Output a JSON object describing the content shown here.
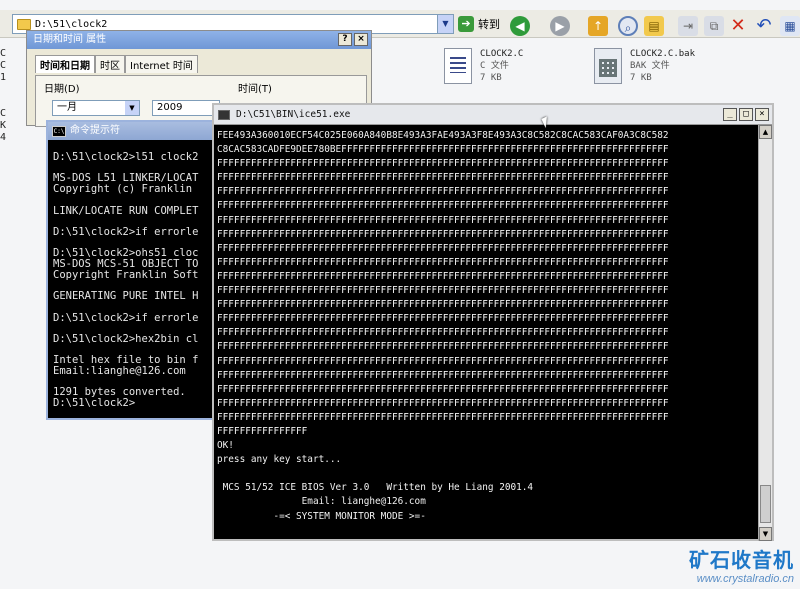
{
  "explorer": {
    "address": "D:\\51\\clock2",
    "go_label": "转到",
    "left_stub_1": "C\nC\n1",
    "left_stub_2": "C\nK\n4",
    "files": [
      {
        "name": "CLOCK2.C",
        "type": "C 文件",
        "size": "7 KB",
        "icon": "c-source-file-icon"
      },
      {
        "name": "CLOCK2.C.bak",
        "type": "BAK 文件",
        "size": "7 KB",
        "icon": "bak-file-icon"
      }
    ],
    "toolbar_icons": [
      "back-icon",
      "forward-icon",
      "up-folder-icon",
      "search-icon",
      "folders-icon",
      "move-to-icon",
      "copy-to-icon",
      "delete-icon",
      "undo-icon",
      "views-icon"
    ]
  },
  "datetime_dialog": {
    "title": "日期和时间 属性",
    "tabs": [
      "时间和日期",
      "时区",
      "Internet 时间"
    ],
    "date_group": "日期(D)",
    "month": "一月",
    "year": "2009",
    "time_group": "时间(T)"
  },
  "cmd_window": {
    "title": "命令提示符",
    "icon_text": "C:\\",
    "content": "D:\\51\\clock2>l51 clock2\n\nMS-DOS L51 LINKER/LOCAT\nCopyright (c) Franklin\n\nLINK/LOCATE RUN COMPLET\n\nD:\\51\\clock2>if errorle\n\nD:\\51\\clock2>ohs51 cloc\nMS-DOS MCS-51 OBJECT TO\nCopyright Franklin Soft\n\nGENERATING PURE INTEL H\n\nD:\\51\\clock2>if errorle\n\nD:\\51\\clock2>hex2bin cl\n\nIntel hex file to bin f\nEmail:lianghe@126.com\n\n1291 bytes converted.\nD:\\51\\clock2>"
  },
  "ice_window": {
    "title": "D:\\C51\\BIN\\ice51.exe",
    "content": "FEE493A360010ECF54C025E060A840B8E493A3FAE493A3F8E493A3C8C582C8CAC583CAF0A3C8C582\nC8CAC583CADFE9DEE780BEFFFFFFFFFFFFFFFFFFFFFFFFFFFFFFFFFFFFFFFFFFFFFFFFFFFFFFFFFF\nFFFFFFFFFFFFFFFFFFFFFFFFFFFFFFFFFFFFFFFFFFFFFFFFFFFFFFFFFFFFFFFFFFFFFFFFFFFFFFFF\nFFFFFFFFFFFFFFFFFFFFFFFFFFFFFFFFFFFFFFFFFFFFFFFFFFFFFFFFFFFFFFFFFFFFFFFFFFFFFFFF\nFFFFFFFFFFFFFFFFFFFFFFFFFFFFFFFFFFFFFFFFFFFFFFFFFFFFFFFFFFFFFFFFFFFFFFFFFFFFFFFF\nFFFFFFFFFFFFFFFFFFFFFFFFFFFFFFFFFFFFFFFFFFFFFFFFFFFFFFFFFFFFFFFFFFFFFFFFFFFFFFFF\nFFFFFFFFFFFFFFFFFFFFFFFFFFFFFFFFFFFFFFFFFFFFFFFFFFFFFFFFFFFFFFFFFFFFFFFFFFFFFFFF\nFFFFFFFFFFFFFFFFFFFFFFFFFFFFFFFFFFFFFFFFFFFFFFFFFFFFFFFFFFFFFFFFFFFFFFFFFFFFFFFF\nFFFFFFFFFFFFFFFFFFFFFFFFFFFFFFFFFFFFFFFFFFFFFFFFFFFFFFFFFFFFFFFFFFFFFFFFFFFFFFFF\nFFFFFFFFFFFFFFFFFFFFFFFFFFFFFFFFFFFFFFFFFFFFFFFFFFFFFFFFFFFFFFFFFFFFFFFFFFFFFFFF\nFFFFFFFFFFFFFFFFFFFFFFFFFFFFFFFFFFFFFFFFFFFFFFFFFFFFFFFFFFFFFFFFFFFFFFFFFFFFFFFF\nFFFFFFFFFFFFFFFFFFFFFFFFFFFFFFFFFFFFFFFFFFFFFFFFFFFFFFFFFFFFFFFFFFFFFFFFFFFFFFFF\nFFFFFFFFFFFFFFFFFFFFFFFFFFFFFFFFFFFFFFFFFFFFFFFFFFFFFFFFFFFFFFFFFFFFFFFFFFFFFFFF\nFFFFFFFFFFFFFFFFFFFFFFFFFFFFFFFFFFFFFFFFFFFFFFFFFFFFFFFFFFFFFFFFFFFFFFFFFFFFFFFF\nFFFFFFFFFFFFFFFFFFFFFFFFFFFFFFFFFFFFFFFFFFFFFFFFFFFFFFFFFFFFFFFFFFFFFFFFFFFFFFFF\nFFFFFFFFFFFFFFFFFFFFFFFFFFFFFFFFFFFFFFFFFFFFFFFFFFFFFFFFFFFFFFFFFFFFFFFFFFFFFFFF\nFFFFFFFFFFFFFFFFFFFFFFFFFFFFFFFFFFFFFFFFFFFFFFFFFFFFFFFFFFFFFFFFFFFFFFFFFFFFFFFF\nFFFFFFFFFFFFFFFFFFFFFFFFFFFFFFFFFFFFFFFFFFFFFFFFFFFFFFFFFFFFFFFFFFFFFFFFFFFFFFFF\nFFFFFFFFFFFFFFFFFFFFFFFFFFFFFFFFFFFFFFFFFFFFFFFFFFFFFFFFFFFFFFFFFFFFFFFFFFFFFFFF\nFFFFFFFFFFFFFFFFFFFFFFFFFFFFFFFFFFFFFFFFFFFFFFFFFFFFFFFFFFFFFFFFFFFFFFFFFFFFFFFF\nFFFFFFFFFFFFFFFFFFFFFFFFFFFFFFFFFFFFFFFFFFFFFFFFFFFFFFFFFFFFFFFFFFFFFFFFFFFFFFFF\nFFFFFFFFFFFFFFFF\nOK!\npress any key start...\n\n MCS 51/52 ICE BIOS Ver 3.0   Written by He Liang 2001.4\n               Email: lianghe@126.com\n          -=< SYSTEM MONITOR MODE >=-\n\n#"
  },
  "watermark": {
    "cn": "矿石收音机",
    "url": "www.crystalradio.cn"
  }
}
